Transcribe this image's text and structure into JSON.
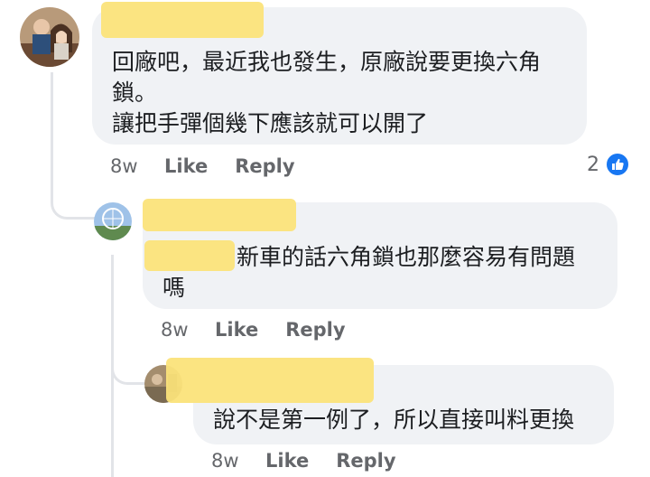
{
  "comments": [
    {
      "author": "",
      "text": "回廠吧，最近我也發生，原廠說要更換六角\n鎖。\n讓把手彈個幾下應該就可以開了",
      "age": "8w",
      "like_label": "Like",
      "reply_label": "Reply",
      "reaction_count": "2",
      "reaction_icon": "thumbs-up-icon"
    },
    {
      "author": "",
      "mention": "",
      "text": "新車的話六角鎖也那麼容易有問題\n嗎",
      "age": "8w",
      "like_label": "Like",
      "reply_label": "Reply"
    },
    {
      "author": "",
      "text": "說不是第一例了，所以直接叫料更換",
      "age": "8w",
      "like_label": "Like",
      "reply_label": "Reply"
    }
  ],
  "colors": {
    "bubble": "#f0f2f5",
    "redaction": "#fbe37a",
    "like_blue": "#1877f2",
    "meta_gray": "#65676b"
  }
}
